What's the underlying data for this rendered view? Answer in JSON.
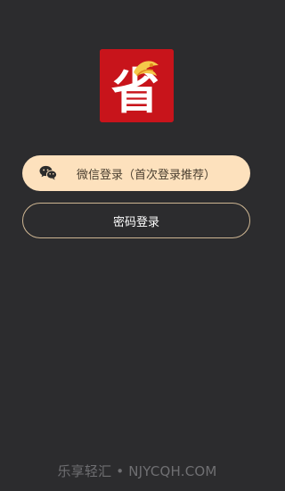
{
  "app": {
    "logo": {
      "char": "省",
      "icon": "app-logo-icon"
    }
  },
  "login": {
    "wechat_label": "微信登录（首次登录推荐）",
    "wechat_icon": "wechat-icon",
    "password_label": "密码登录"
  },
  "footer": {
    "watermark": "乐享轻汇 • NJYCQH.COM"
  },
  "colors": {
    "background": "#2c2c2e",
    "logo_red": "#c8141b",
    "wechat_button": "#fde1bd",
    "password_border": "#cdb592"
  }
}
